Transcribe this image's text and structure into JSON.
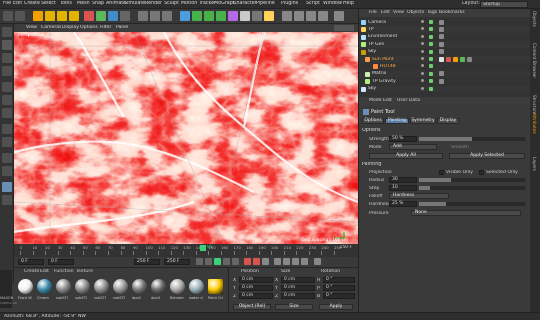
{
  "menubar": {
    "items": [
      "File",
      "Edit",
      "Create",
      "Select",
      "Tools",
      "Mesh",
      "Snap",
      "Animate",
      "Simulate",
      "Render",
      "Sculpt",
      "Motion Tracker",
      "MoGraph",
      "Character",
      "Pipeline",
      "Plugins",
      "Script",
      "Window",
      "Help"
    ],
    "layout_label": "Layout:",
    "layout_value": "Startup"
  },
  "viewport": {
    "menu": [
      "View",
      "Cameras",
      "Display",
      "Options",
      "Filter",
      "Panel"
    ],
    "camera_label": "Perspective",
    "grid_label": "Grid Spacing : 100 cm"
  },
  "timeline": {
    "ticks": [
      "0",
      "10",
      "20",
      "30",
      "40",
      "50",
      "60",
      "70",
      "80",
      "90",
      "100",
      "110",
      "120",
      "130",
      "140",
      "150",
      "160",
      "170",
      "180",
      "190",
      "200",
      "210",
      "220",
      "230",
      "240",
      "250"
    ],
    "current_frame": "95",
    "end_frame": "250 F",
    "start_field": "0 F",
    "field2": "0 F",
    "field3": "250 F",
    "field4": "250 F"
  },
  "materials": {
    "menu": [
      "Create",
      "Edit",
      "Function",
      "Texture"
    ],
    "items": [
      "Front W",
      "Chrom",
      "subSTI",
      "subSTI",
      "subSTI",
      "subSTI",
      "dpo2",
      "dpo3",
      "Blender",
      "water d",
      "Paint Cri"
    ],
    "brand": "MAXON",
    "brand2": "CINEMA 4D"
  },
  "coordinates": {
    "headers": [
      "Position",
      "Size",
      "Rotation"
    ],
    "rows": [
      {
        "axis": "X",
        "pos": "0 cm",
        "size": "0 cm",
        "rot_axis": "H",
        "rot": "0 °"
      },
      {
        "axis": "Y",
        "pos": "0 cm",
        "size": "0 cm",
        "rot_axis": "P",
        "rot": "0 °"
      },
      {
        "axis": "Z",
        "pos": "0 cm",
        "size": "0 cm",
        "rot_axis": "B",
        "rot": "0 °"
      }
    ],
    "mode_select": "Object (Rel)",
    "size_select": "Size",
    "apply": "Apply"
  },
  "objects": {
    "menu": [
      "File",
      "Edit",
      "View",
      "Objects",
      "Tags",
      "Bookmarks"
    ],
    "rows": [
      {
        "name": "Camera",
        "color": "#8fd6ff"
      },
      {
        "name": "TP",
        "color": "#ffd35a"
      },
      {
        "name": "Environment",
        "color": "#b6e0ff"
      },
      {
        "name": "TP Gen",
        "color": "#b0f080"
      },
      {
        "name": "Sky",
        "color": "#c9a000"
      },
      {
        "name": "Sun Paint",
        "color": "#ff9a4a"
      },
      {
        "name": "HOT48",
        "color": "#ff8a40"
      },
      {
        "name": "Matrix",
        "color": "#c8f0b0"
      },
      {
        "name": "TP Gravity",
        "color": "#b0f080"
      },
      {
        "name": "Sky",
        "color": "#cfe8ff"
      }
    ]
  },
  "attributes": {
    "menu": [
      "Mode",
      "Edit",
      "User Data"
    ],
    "tool_title": "Paint Tool",
    "tabs": [
      "Options",
      "Painting",
      "Symmetry",
      "Display"
    ],
    "section_options": "Options",
    "strength_label": "Strength",
    "strength_value": "50 %",
    "strength_fraction": 0.5,
    "mode_label": "Mode",
    "mode_value": "Add",
    "smooth_label": "Smooth",
    "apply_all": "Apply All",
    "apply_selected": "Apply Selected",
    "section_painting": "Painting",
    "projection_label": "Projection",
    "visible_only": "Visible Only",
    "selected_only": "Selected Only",
    "radius_label": "Radius",
    "radius_value": "30",
    "radius_fraction": 0.3,
    "step_label": "Step",
    "step_value": "10",
    "step_fraction": 0.1,
    "falloff_label": "Falloff",
    "falloff_value": "Hardness",
    "hardness_label": "Hardness",
    "hardness_value": "25 %",
    "hardness_fraction": 0.25,
    "pressure_label": "Pressure",
    "pressure_value": "None"
  },
  "sidetabs": [
    "Objects",
    "Content Browser",
    "Structure",
    "Attributes",
    "Layers"
  ],
  "status": {
    "text": "Azimuth: 68.8°, Altitude: -54.9°  NW"
  },
  "colors": {
    "accent": "#ff8a00",
    "paint_red": "#ff0000",
    "paint_white": "#fff4ea",
    "timeline_marker": "#3bd17b"
  }
}
